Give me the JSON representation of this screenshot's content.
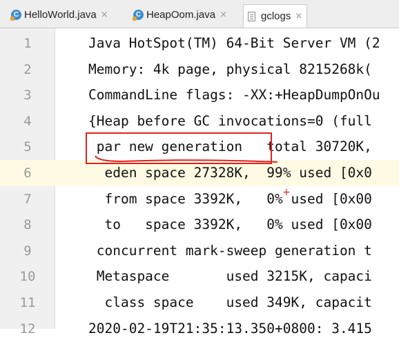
{
  "tabs": [
    {
      "label": "HelloWorld.java",
      "icon": "java-class-icon",
      "close": "×"
    },
    {
      "label": "HeapOom.java",
      "icon": "java-class-icon",
      "close": "×"
    },
    {
      "label": "gclogs",
      "icon": "text-file-icon",
      "close": "×"
    }
  ],
  "active_tab": "gclogs",
  "current_line": 6,
  "lines": [
    {
      "num": "1",
      "text": "Java HotSpot(TM) 64-Bit Server VM (2"
    },
    {
      "num": "2",
      "text": "Memory: 4k page, physical 8215268k("
    },
    {
      "num": "3",
      "text": "CommandLine flags: -XX:+HeapDumpOnOu"
    },
    {
      "num": "4",
      "text": "{Heap before GC invocations=0 (full"
    },
    {
      "num": "5",
      "text": " par new generation   total 30720K,"
    },
    {
      "num": "6",
      "text": "  eden space 27328K,  99% used [0x0"
    },
    {
      "num": "7",
      "text": "  from space 3392K,   0% used [0x00"
    },
    {
      "num": "8",
      "text": "  to   space 3392K,   0% used [0x00"
    },
    {
      "num": "9",
      "text": " concurrent mark-sweep generation t"
    },
    {
      "num": "10",
      "text": " Metaspace       used 3215K, capaci"
    },
    {
      "num": "11",
      "text": "  class space    used 349K, capacit"
    },
    {
      "num": "12",
      "text": "2020-02-19T21:35:13.350+0800: 3.415"
    }
  ],
  "colors": {
    "annotation": "#e02020",
    "current_line": "#fffae3",
    "gutter": "#f0f0f0",
    "line_number": "#999999"
  }
}
